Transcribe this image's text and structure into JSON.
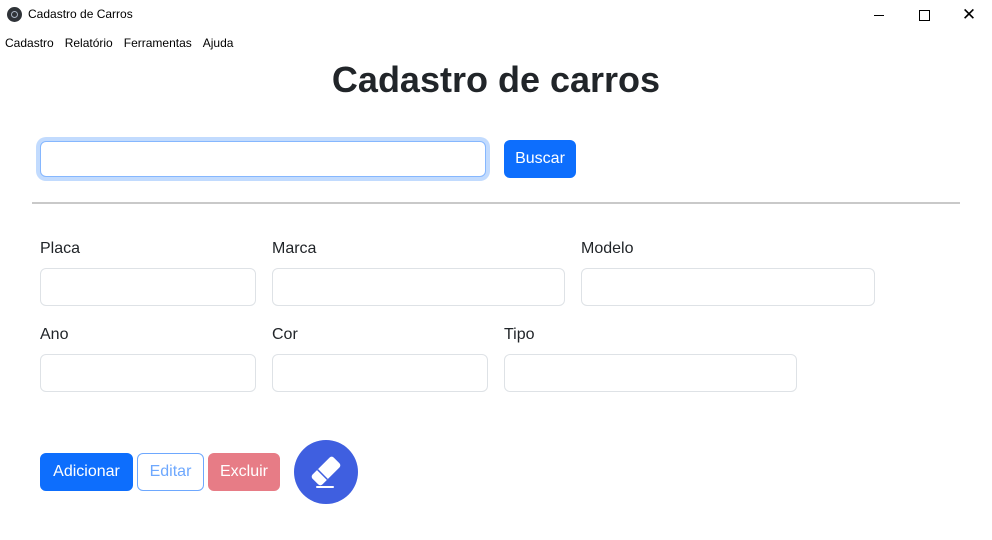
{
  "window": {
    "title": "Cadastro de Carros",
    "controls": {
      "minimize": "minimize-icon",
      "maximize": "maximize-icon",
      "close": "close-icon"
    }
  },
  "menu": [
    "Cadastro",
    "Relatório",
    "Ferramentas",
    "Ajuda"
  ],
  "page": {
    "title": "Cadastro de carros"
  },
  "search": {
    "value": "",
    "placeholder": "",
    "button_label": "Buscar"
  },
  "form": {
    "placa": {
      "label": "Placa",
      "value": ""
    },
    "marca": {
      "label": "Marca",
      "value": ""
    },
    "modelo": {
      "label": "Modelo",
      "value": ""
    },
    "ano": {
      "label": "Ano",
      "value": ""
    },
    "cor": {
      "label": "Cor",
      "value": ""
    },
    "tipo": {
      "label": "Tipo",
      "value": ""
    }
  },
  "actions": {
    "adicionar": "Adicionar",
    "editar": "Editar",
    "excluir": "Excluir",
    "clear_icon": "eraser-icon"
  },
  "colors": {
    "primary": "#0d6efd",
    "danger_disabled": "#e77c86",
    "outline_disabled": "#6ea8fe",
    "eraser_circle": "#3f5fe0"
  }
}
